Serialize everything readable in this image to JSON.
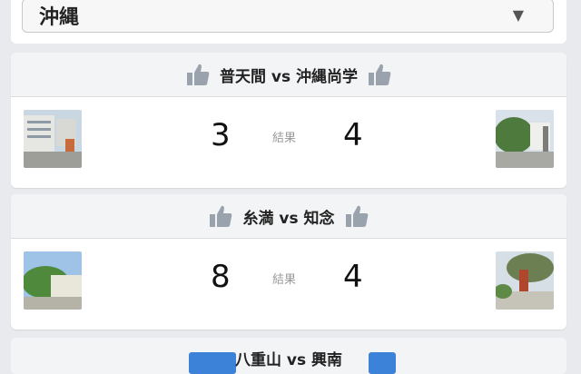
{
  "region_select": {
    "value": "沖縄",
    "arrow": "▼"
  },
  "games": [
    {
      "title": "普天間 vs 沖縄尚学",
      "home_score": "3",
      "result_label": "結果",
      "away_score": "4"
    },
    {
      "title": "糸満 vs 知念",
      "home_score": "8",
      "result_label": "結果",
      "away_score": "4"
    }
  ],
  "partial_game": {
    "title": "八重山 vs 興南"
  },
  "colors": {
    "accent": "#3b82d8",
    "thumb": "#9aa3ad"
  }
}
